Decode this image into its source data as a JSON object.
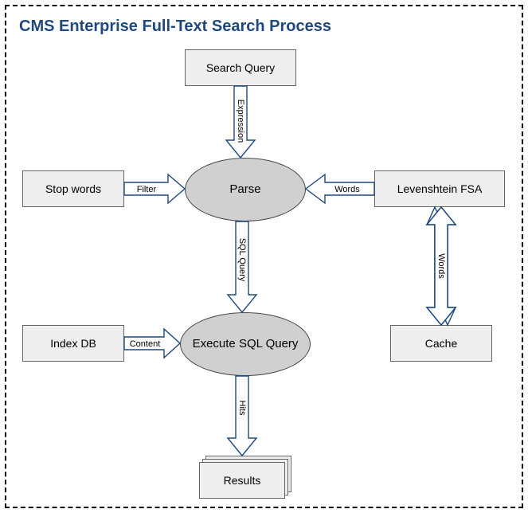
{
  "title": "CMS Enterprise Full-Text Search Process",
  "nodes": {
    "search_query": "Search Query",
    "stop_words": "Stop words",
    "parse": "Parse",
    "levenshtein": "Levenshtein FSA",
    "index_db": "Index DB",
    "exec": "Execute SQL Query",
    "cache": "Cache",
    "results": "Results"
  },
  "edges": {
    "expression": "Expression",
    "filter": "Filter",
    "words_in": "Words",
    "sql_query": "SQL Query",
    "content": "Content",
    "words_cache": "Words",
    "hits": "Hits"
  }
}
